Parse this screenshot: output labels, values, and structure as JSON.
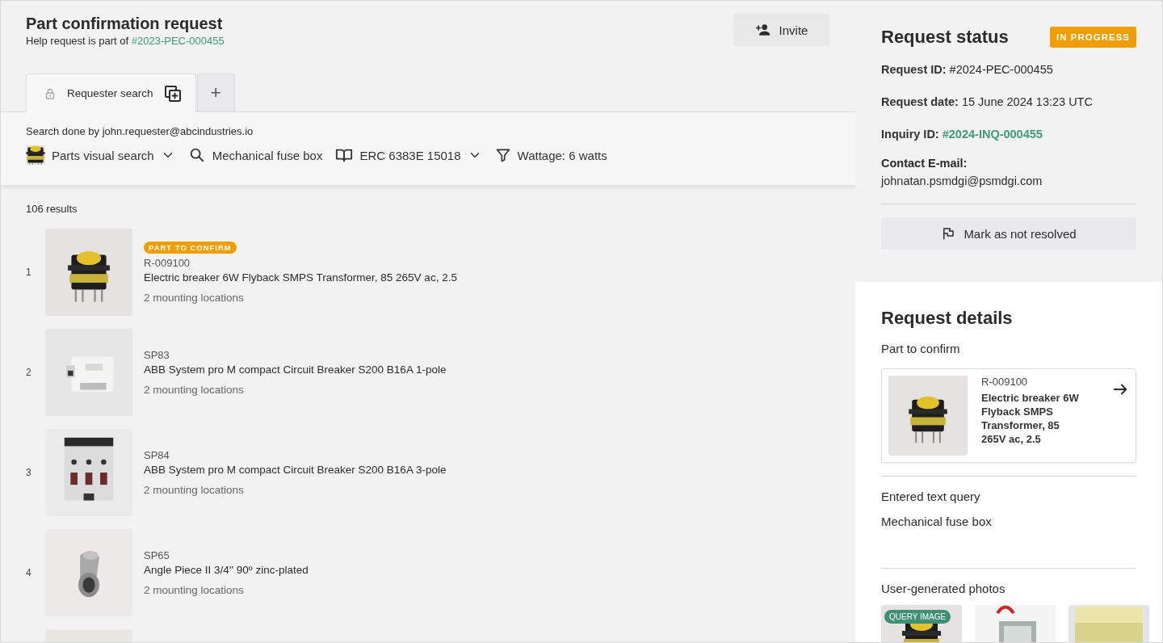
{
  "header": {
    "title": "Part confirmation request",
    "subtitle": "Help request is part of",
    "subtitle_link": "#2023-PEC-000455",
    "invite_button": "Invite"
  },
  "tabs": [
    {
      "kind": "search",
      "label": "Requester search",
      "selected": true
    },
    {
      "kind": "add",
      "label": "+",
      "selected": false
    }
  ],
  "search": {
    "done_by": "Search done by john.requester@abcindustries.io",
    "filters": [
      {
        "label": "Parts visual search",
        "dropdown": true
      },
      {
        "kind": "text",
        "label": "Mechanical fuse box",
        "dropdown": false
      },
      {
        "kind": "catalog",
        "label": "ERC 6383E 15018",
        "dropdown": true
      },
      {
        "kind": "filter",
        "label": "Wattage: 6 watts",
        "dropdown": false
      }
    ]
  },
  "results": {
    "count": "106 results",
    "rows": [
      {
        "kind": "part",
        "index": "1",
        "badge": "PART TO CONFIRM",
        "code": "R-009100",
        "name": "Electric breaker 6W Flyback SMPS Transformer, 85 265V ac, 2.5",
        "locations": "2 mounting locations"
      },
      {
        "kind": "part",
        "index": "2",
        "code": "SP83",
        "name": "ABB System pro M compact Circuit Breaker S200 B16A 1-pole",
        "locations": "2 mounting locations"
      },
      {
        "kind": "part",
        "index": "3",
        "code": "SP84",
        "name": "ABB System pro M compact Circuit Breaker S200 B16A 3-pole",
        "locations": "2 mounting locations"
      },
      {
        "kind": "part",
        "index": "4",
        "code": "SP65",
        "name": "Angle Piece II 3/4'' 90º zinc-plated",
        "locations": "2 mounting locations"
      },
      {
        "kind": "picture"
      }
    ]
  },
  "status": {
    "title": "Request status",
    "badge": "IN PROGRESS",
    "fields": [
      {
        "kind": "plain",
        "label": "Request ID:",
        "value": "#2024-PEC-000455"
      },
      {
        "kind": "plain",
        "label": "Request date:",
        "value": "15 June 2024 13:23 UTC"
      },
      {
        "kind": "link",
        "label": "Inquiry ID:",
        "value": "#2024-INQ-000455"
      },
      {
        "kind": "stacked",
        "label": "Contact E-mail:",
        "value": "johnatan.psmdgi@psmdgi.com"
      }
    ],
    "button": "Mark as not resolved"
  },
  "details": {
    "title": "Request details",
    "part_heading": "Part to confirm",
    "part": {
      "code": "R-009100",
      "name": "Electric breaker 6W Flyback SMPS Transformer, 85 265V ac, 2.5"
    },
    "query_heading": "Entered text query",
    "query": "Mechanical fuse box",
    "photos_heading": "User-generated photos",
    "photos": [
      {
        "kind": "query",
        "badge": "QUERY IMAGE"
      },
      {
        "kind": "picture"
      },
      {
        "kind": "picture"
      }
    ]
  }
}
